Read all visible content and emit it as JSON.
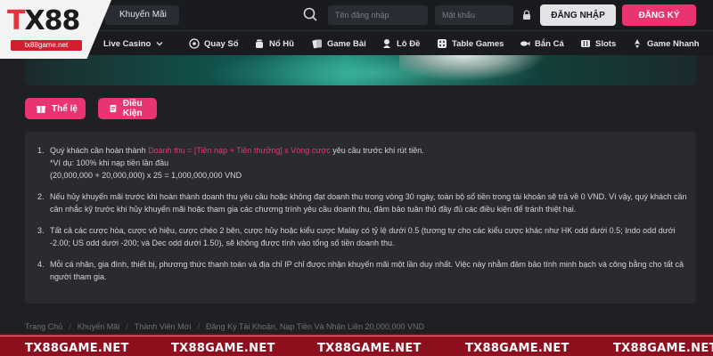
{
  "header": {
    "promo_tab": "Khuyến Mãi",
    "username_placeholder": "Tên đăng nhập",
    "password_placeholder": "Mật khẩu",
    "login_label": "ĐĂNG NHẬP",
    "register_label": "ĐĂNG KÝ"
  },
  "logo": {
    "text_prefix": "T",
    "text_rest": "X88",
    "url": "tx88game.net"
  },
  "nav": [
    {
      "label": "Live Casino",
      "icon": "live-casino-icon"
    },
    {
      "label": "Quay Số",
      "icon": "lottery-icon"
    },
    {
      "label": "Nổ Hũ",
      "icon": "jackpot-icon"
    },
    {
      "label": "Game Bài",
      "icon": "cards-icon"
    },
    {
      "label": "Lô Đề",
      "icon": "lode-icon"
    },
    {
      "label": "Table Games",
      "icon": "dice-icon"
    },
    {
      "label": "Bắn Cá",
      "icon": "fish-icon"
    },
    {
      "label": "Slots",
      "icon": "slots-icon"
    },
    {
      "label": "Game Nhanh",
      "icon": "rocket-icon"
    }
  ],
  "tabs": {
    "rules": "Thể lệ",
    "conditions": "Điều Kiện"
  },
  "conditions": {
    "item1": {
      "num": "1.",
      "before": "Quý khách cần hoàn thành ",
      "highlight": "Doanh thu = [Tiền nạp + Tiền thưởng] x Vòng cược",
      "after": " yêu cầu trước khi rút tiền.",
      "example": "*Ví dụ: 100% khi nạp tiền lần đầu",
      "formula": "(20,000,000 + 20,000,000) x 25 = 1,000,000,000 VND"
    },
    "item2": {
      "num": "2.",
      "text": "Nếu hủy khuyến mãi trước khi hoàn thành doanh thu yêu cầu hoặc không đạt doanh thu trong vòng 30 ngày, toàn bộ số tiền trong tài khoản sẽ trả về 0 VND. Vì vậy, quý khách cần cân nhắc kỹ trước khi hủy khuyến mãi hoặc tham gia các chương trình yêu cầu doanh thu, đảm bảo tuân thủ đầy đủ các điều kiện để tránh thiệt hại."
    },
    "item3": {
      "num": "3.",
      "text": "Tất cả các cược hòa, cược vô hiệu, cược chéo 2 bên, cược hủy hoặc kiểu cược Malay có tỷ lệ dưới 0.5 (tương tự cho các kiểu cược khác như HK odd dưới 0.5; Indo odd dưới -2.00; US odd dưới -200; và Dec odd dưới 1.50), sẽ không được tính vào tổng số tiền doanh thu."
    },
    "item4": {
      "num": "4.",
      "text": "Mỗi cá nhân, gia đình, thiết bị, phương thức thanh toán và địa chỉ IP chỉ được nhận khuyến mãi một lần duy nhất. Việc này nhằm đảm bảo tính minh bạch và công bằng cho tất cả người tham gia."
    }
  },
  "breadcrumb": {
    "home": "Trang Chủ",
    "promo": "Khuyến Mãi",
    "members": "Thành Viên Mới",
    "current": "Đăng Ký Tài Khoản, Nạp Tiền Và Nhận Liền 20,000,000 VND",
    "separator": "/"
  },
  "footer": {
    "watermark": "TX88GAME.NET"
  },
  "colors": {
    "accent": "#e8356f",
    "background": "#1f2024",
    "panel": "#2a2b31",
    "footer_red": "#8e0f1e"
  }
}
